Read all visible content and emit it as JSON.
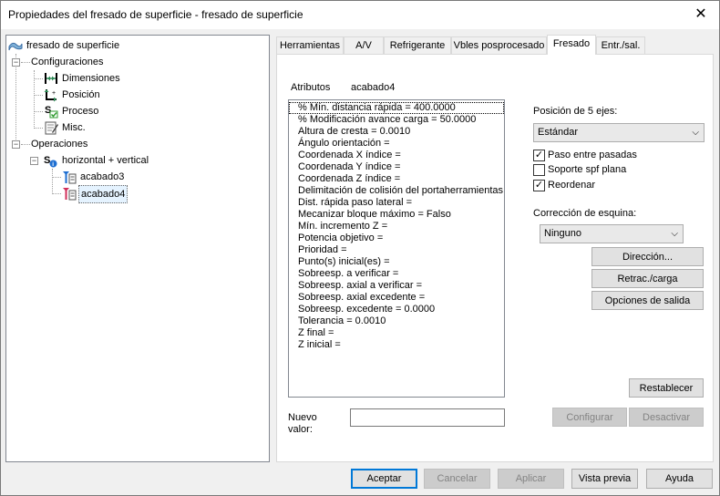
{
  "window": {
    "title": "Propiedades del fresado de superficie - fresado de superficie",
    "close_glyph": "✕"
  },
  "tree": {
    "root": "fresado de superficie",
    "configuraciones": "Configuraciones",
    "config_items": [
      "Dimensiones",
      "Posición",
      "Proceso",
      "Misc."
    ],
    "operaciones": "Operaciones",
    "group": "horizontal + vertical",
    "ops": [
      "acabado3",
      "acabado4"
    ],
    "expander_minus": "−"
  },
  "tabs": [
    "Herramientas",
    "A/V",
    "Refrigerante",
    "Vbles posprocesado",
    "Fresado",
    "Entr./sal."
  ],
  "active_tab": "Fresado",
  "attributes": {
    "header_label": "Atributos",
    "header_value": "acabado4",
    "items": [
      "% Mín. distancia rápida = 400.0000",
      "% Modificación avance carga = 50.0000",
      "Altura de cresta = 0.0010",
      "Ángulo orientación =",
      "Coordenada X índice =",
      "Coordenada Y índice =",
      "Coordenada Z índice =",
      "Delimitación de colisión del portaherramientas =",
      "Dist. rápida paso lateral =",
      "Mecanizar bloque máximo = Falso",
      "Mín. incremento Z =",
      "Potencia objetivo  =",
      "Prioridad =",
      "Punto(s) inicial(es) =",
      "Sobreesp. a verificar =",
      "Sobreesp. axial a verificar =",
      "Sobreesp. axial excedente =",
      "Sobreesp. excedente = 0.0000",
      "Tolerancia = 0.0010",
      "Z final =",
      "Z inicial ="
    ]
  },
  "nuevo_valor": {
    "label_line1": "Nuevo",
    "label_line2": "valor:",
    "value": ""
  },
  "five_axis": {
    "label": "Posición de 5 ejes:",
    "selected": "Estándar"
  },
  "checkboxes": [
    {
      "label": "Paso entre pasadas",
      "checked": true
    },
    {
      "label": "Soporte spf plana",
      "checked": false
    },
    {
      "label": "Reordenar",
      "checked": true
    }
  ],
  "check_glyph": "✓",
  "corner": {
    "label": "Corrección de esquina:",
    "selected": "Ninguno"
  },
  "dropdown_arrow": "⌵",
  "side_buttons": {
    "direccion": "Dirección...",
    "retrac": "Retrac./carga",
    "opciones": "Opciones de salida",
    "restablecer": "Restablecer",
    "configurar": "Configurar",
    "desactivar": "Desactivar"
  },
  "footer_buttons": {
    "aceptar": "Aceptar",
    "cancelar": "Cancelar",
    "aplicar": "Aplicar",
    "vista_previa": "Vista previa",
    "ayuda": "Ayuda"
  },
  "colors": {
    "accent": "#0078d7",
    "dimension_icon": "#000000",
    "proceso_check": "#2e9b2e"
  }
}
